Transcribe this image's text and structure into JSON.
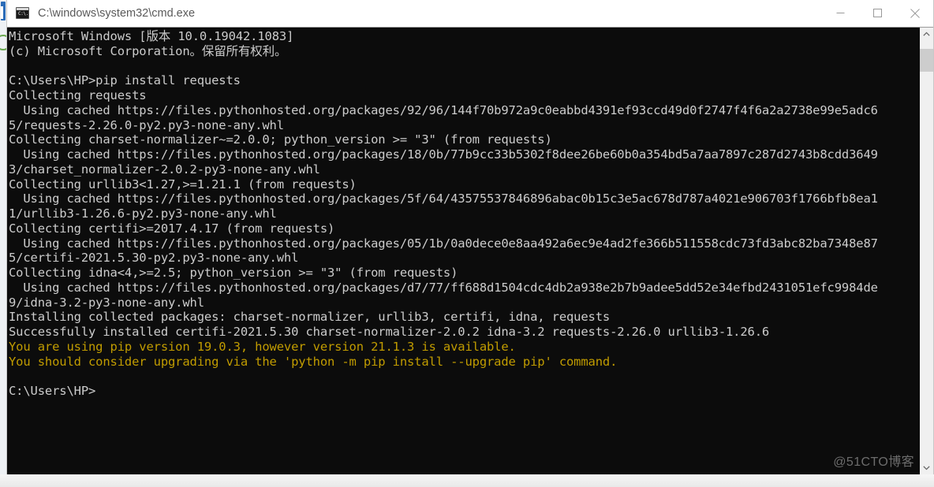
{
  "window": {
    "title": "C:\\windows\\system32\\cmd.exe",
    "icon": "cmd-icon",
    "prompt_glyph": "C:\\.",
    "controls": {
      "minimize_label": "Minimize",
      "maximize_label": "Maximize",
      "close_label": "Close"
    }
  },
  "console": {
    "background_color": "#0c0c0c",
    "foreground_color": "#cccccc",
    "warning_color": "#c19c00",
    "lines": [
      {
        "text": "Microsoft Windows [版本 10.0.19042.1083]",
        "style": "normal"
      },
      {
        "text": "(c) Microsoft Corporation。保留所有权利。",
        "style": "normal"
      },
      {
        "text": "",
        "style": "normal"
      },
      {
        "text": "C:\\Users\\HP>pip install requests",
        "style": "normal"
      },
      {
        "text": "Collecting requests",
        "style": "normal"
      },
      {
        "text": "  Using cached https://files.pythonhosted.org/packages/92/96/144f70b972a9c0eabbd4391ef93ccd49d0f2747f4f6a2a2738e99e5adc6",
        "style": "normal"
      },
      {
        "text": "5/requests-2.26.0-py2.py3-none-any.whl",
        "style": "normal"
      },
      {
        "text": "Collecting charset-normalizer~=2.0.0; python_version >= \"3\" (from requests)",
        "style": "normal"
      },
      {
        "text": "  Using cached https://files.pythonhosted.org/packages/18/0b/77b9cc33b5302f8dee26be60b0a354bd5a7aa7897c287d2743b8cdd3649",
        "style": "normal"
      },
      {
        "text": "3/charset_normalizer-2.0.2-py3-none-any.whl",
        "style": "normal"
      },
      {
        "text": "Collecting urllib3<1.27,>=1.21.1 (from requests)",
        "style": "normal"
      },
      {
        "text": "  Using cached https://files.pythonhosted.org/packages/5f/64/43575537846896abac0b15c3e5ac678d787a4021e906703f1766bfb8ea1",
        "style": "normal"
      },
      {
        "text": "1/urllib3-1.26.6-py2.py3-none-any.whl",
        "style": "normal"
      },
      {
        "text": "Collecting certifi>=2017.4.17 (from requests)",
        "style": "normal"
      },
      {
        "text": "  Using cached https://files.pythonhosted.org/packages/05/1b/0a0dece0e8aa492a6ec9e4ad2fe366b511558cdc73fd3abc82ba7348e87",
        "style": "normal"
      },
      {
        "text": "5/certifi-2021.5.30-py2.py3-none-any.whl",
        "style": "normal"
      },
      {
        "text": "Collecting idna<4,>=2.5; python_version >= \"3\" (from requests)",
        "style": "normal"
      },
      {
        "text": "  Using cached https://files.pythonhosted.org/packages/d7/77/ff688d1504cdc4db2a938e2b7b9adee5dd52e34efbd2431051efc9984de",
        "style": "normal"
      },
      {
        "text": "9/idna-3.2-py3-none-any.whl",
        "style": "normal"
      },
      {
        "text": "Installing collected packages: charset-normalizer, urllib3, certifi, idna, requests",
        "style": "normal"
      },
      {
        "text": "Successfully installed certifi-2021.5.30 charset-normalizer-2.0.2 idna-3.2 requests-2.26.0 urllib3-1.26.6",
        "style": "normal"
      },
      {
        "text": "You are using pip version 19.0.3, however version 21.1.3 is available.",
        "style": "warn"
      },
      {
        "text": "You should consider upgrading via the 'python -m pip install --upgrade pip' command.",
        "style": "warn"
      },
      {
        "text": "",
        "style": "normal"
      },
      {
        "text": "C:\\Users\\HP>",
        "style": "normal"
      }
    ]
  },
  "scrollbar": {
    "up_arrow": "chevron-up",
    "down_arrow": "chevron-down",
    "thumb_position_percent": 2
  },
  "watermark": {
    "text": "@51CTO博客"
  }
}
